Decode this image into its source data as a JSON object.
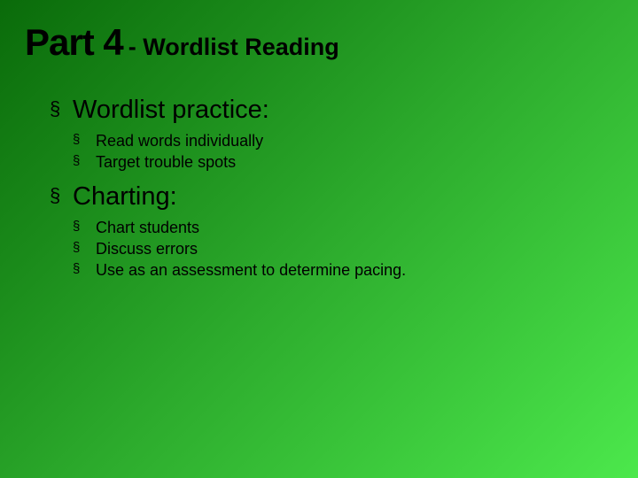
{
  "title": {
    "main": "Part 4",
    "sub": "- Wordlist Reading"
  },
  "sections": [
    {
      "heading": "Wordlist practice:",
      "items": [
        "Read words individually",
        "Target trouble spots"
      ]
    },
    {
      "heading": "Charting:",
      "items": [
        "Chart students",
        "Discuss errors",
        "Use as an assessment to determine pacing."
      ]
    }
  ]
}
